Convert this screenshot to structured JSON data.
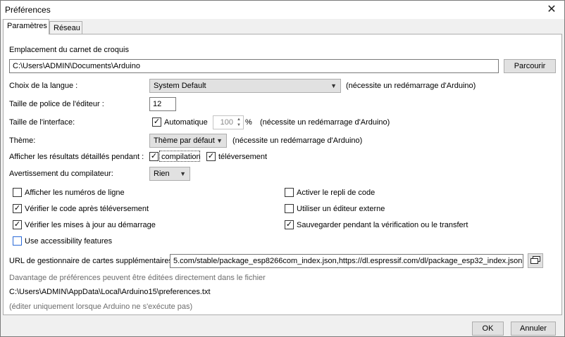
{
  "window": {
    "title": "Préférences"
  },
  "tabs": [
    {
      "label": "Paramètres"
    },
    {
      "label": "Réseau"
    }
  ],
  "sketchbook": {
    "label": "Emplacement du carnet de croquis",
    "path": "C:\\Users\\ADMIN\\Documents\\Arduino",
    "browse_label": "Parcourir"
  },
  "language": {
    "label": "Choix de la langue :",
    "value": "System Default",
    "note": "(nécessite un redémarrage d'Arduino)"
  },
  "editor_font": {
    "label": "Taille de police de l'éditeur :",
    "value": "12"
  },
  "interface_scale": {
    "label": "Taille de l'interface:",
    "auto_label": "Automatique",
    "value": "100",
    "unit": "%",
    "note": "(nécessite un redémarrage d'Arduino)"
  },
  "theme": {
    "label": "Thème:",
    "value": "Thème par défaut",
    "note": "(nécessite un redémarrage d'Arduino)"
  },
  "verbose": {
    "label": "Afficher les résultats détaillés pendant :",
    "compile_label": "compilation",
    "upload_label": "téléversement"
  },
  "warnings": {
    "label": "Avertissement du compilateur:",
    "value": "Rien"
  },
  "options_left": [
    {
      "label": "Afficher les numéros de ligne",
      "checked": false
    },
    {
      "label": "Vérifier le code après téléversement",
      "checked": true
    },
    {
      "label": "Vérifier les mises à jour au démarrage",
      "checked": true
    },
    {
      "label": "Use accessibility features",
      "checked": false
    }
  ],
  "options_right": [
    {
      "label": "Activer le repli de code",
      "checked": false
    },
    {
      "label": "Utiliser un éditeur externe",
      "checked": false
    },
    {
      "label": "Sauvegarder pendant la vérification ou le transfert",
      "checked": true
    }
  ],
  "boards_url": {
    "label": "URL de gestionnaire de cartes supplémentaires",
    "value": "5.com/stable/package_esp8266com_index.json,https://dl.espressif.com/dl/package_esp32_index.json"
  },
  "info": {
    "line1": "Davantage de préférences peuvent être éditées directement dans le fichier",
    "path": "C:\\Users\\ADMIN\\AppData\\Local\\Arduino15\\preferences.txt",
    "line3": "(éditer uniquement lorsque Arduino ne s'exécute pas)"
  },
  "footer": {
    "ok_label": "OK",
    "cancel_label": "Annuler"
  },
  "colors": {
    "window_bg": "#f0f0f0",
    "panel_bg": "#ffffff",
    "accent_blue": "#2a6ad8",
    "muted_text": "#6d6d6d"
  }
}
